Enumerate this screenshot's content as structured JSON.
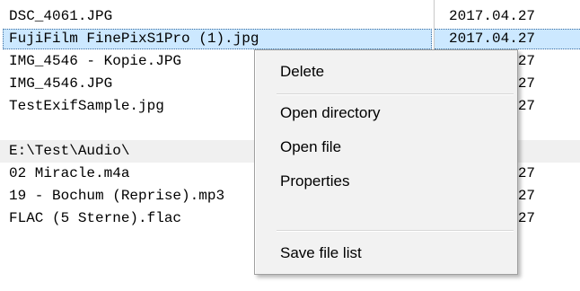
{
  "files": [
    {
      "name": "DSC_4061.JPG",
      "date": "2017.04.27",
      "kind": "file"
    },
    {
      "name": "FujiFilm FinePixS1Pro (1).jpg",
      "date": "2017.04.27",
      "kind": "file",
      "selected": true
    },
    {
      "name": "IMG_4546 - Kopie.JPG",
      "date": "2017.04.27",
      "kind": "file"
    },
    {
      "name": "IMG_4546.JPG",
      "date": "2017.04.27",
      "kind": "file"
    },
    {
      "name": "TestExifSample.jpg",
      "date": "2017.04.27",
      "kind": "file"
    },
    {
      "name": "",
      "date": "",
      "kind": "blank"
    },
    {
      "name": "E:\\Test\\Audio\\",
      "date": "",
      "kind": "group"
    },
    {
      "name": "02 Miracle.m4a",
      "date": "2017.04.27",
      "kind": "file"
    },
    {
      "name": "19 - Bochum (Reprise).mp3",
      "date": "2017.04.27",
      "kind": "file"
    },
    {
      "name": "FLAC (5 Sterne).flac",
      "date": "2017.04.27",
      "kind": "file"
    }
  ],
  "context_menu": {
    "items": [
      {
        "label": "Delete",
        "id": "delete"
      },
      {
        "label": "Open directory",
        "id": "open-directory"
      },
      {
        "label": "Open file",
        "id": "open-file"
      },
      {
        "label": "Properties",
        "id": "properties"
      },
      {
        "label": "Save file list",
        "id": "save-file-list"
      }
    ]
  }
}
